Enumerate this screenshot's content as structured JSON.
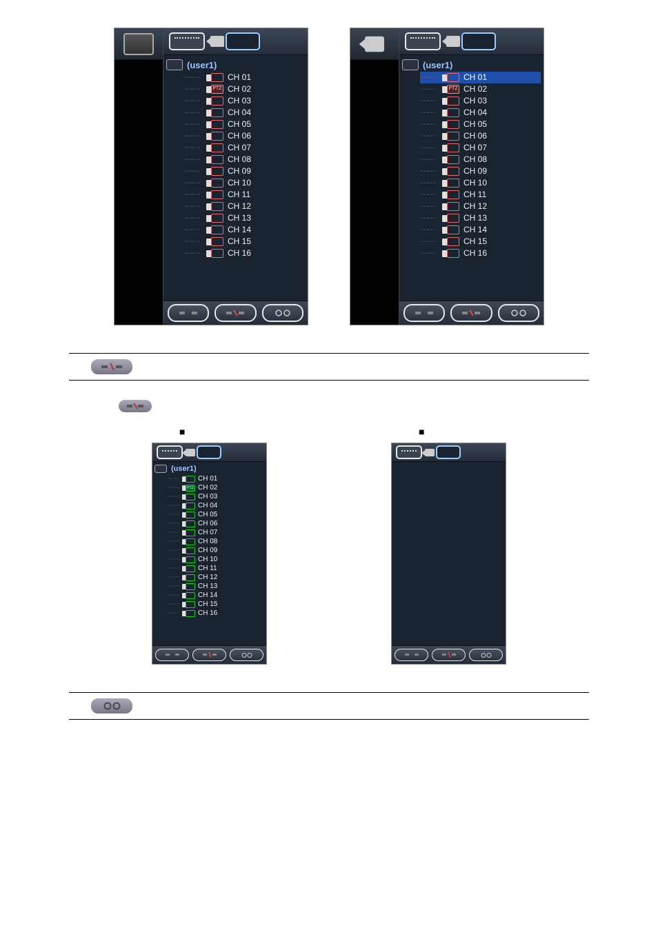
{
  "panels": {
    "top_left": {
      "user": "(user1)",
      "channels": [
        "CH 01",
        "CH 02",
        "CH 03",
        "CH 04",
        "CH 05",
        "CH 06",
        "CH 07",
        "CH 08",
        "CH 09",
        "CH 10",
        "CH 11",
        "CH 12",
        "CH 13",
        "CH 14",
        "CH 15",
        "CH 16"
      ],
      "ptz_index": 1,
      "highlight_index": -1,
      "icon_color": "red"
    },
    "top_right": {
      "user": "(user1)",
      "channels": [
        "CH 01",
        "CH 02",
        "CH 03",
        "CH 04",
        "CH 05",
        "CH 06",
        "CH 07",
        "CH 08",
        "CH 09",
        "CH 10",
        "CH 11",
        "CH 12",
        "CH 13",
        "CH 14",
        "CH 15",
        "CH 16"
      ],
      "ptz_index": 1,
      "highlight_index": 0,
      "icon_color": "red"
    },
    "bottom_left": {
      "user": "(user1)",
      "channels": [
        "CH 01",
        "CH 02",
        "CH 03",
        "CH 04",
        "CH 05",
        "CH 06",
        "CH 07",
        "CH 08",
        "CH 09",
        "CH 10",
        "CH 11",
        "CH 12",
        "CH 13",
        "CH 14",
        "CH 15",
        "CH 16"
      ],
      "ptz_index": 1,
      "highlight_index": -1,
      "icon_color": "green"
    },
    "bottom_right": {
      "user": "",
      "channels": [],
      "ptz_index": -1,
      "highlight_index": -1,
      "icon_color": "red"
    }
  },
  "icons": {
    "btn1": "connect-icon",
    "btn2": "disconnect-icon",
    "btn3": "settings-icon"
  }
}
